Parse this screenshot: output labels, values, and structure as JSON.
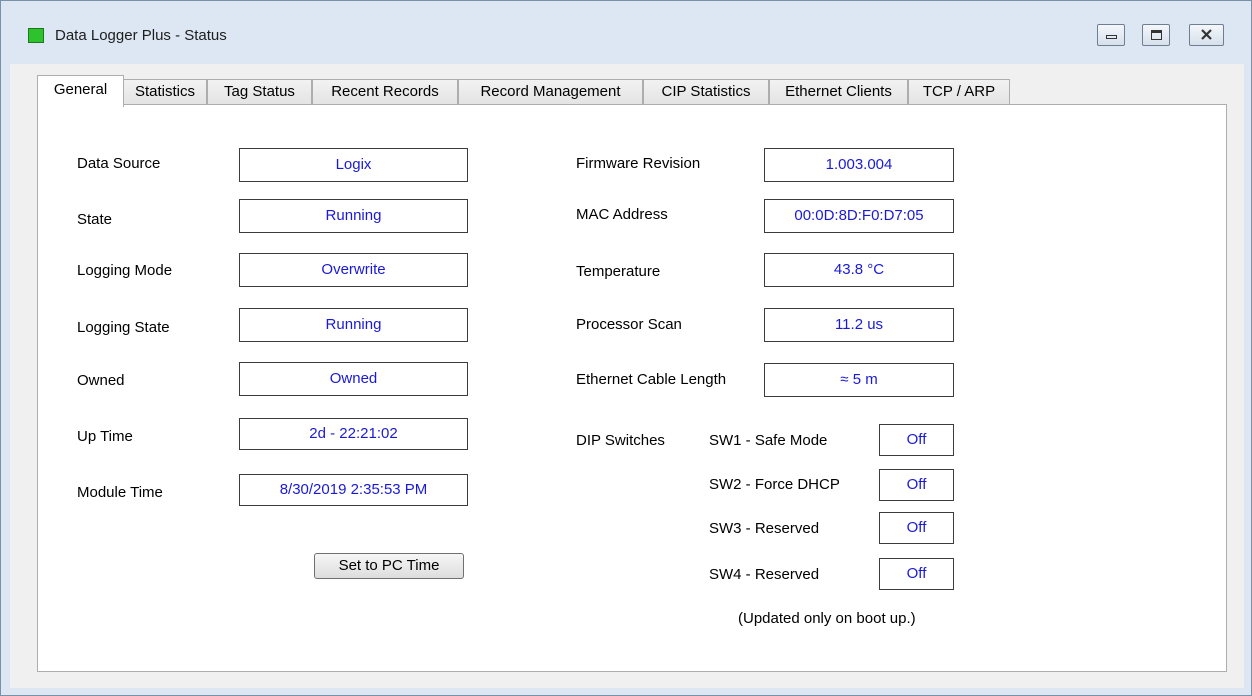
{
  "window": {
    "title": "Data Logger Plus - Status",
    "icon": "green-square-icon"
  },
  "tabs": [
    {
      "label": "General",
      "active": true
    },
    {
      "label": "Statistics",
      "active": false
    },
    {
      "label": "Tag Status",
      "active": false
    },
    {
      "label": "Recent Records",
      "active": false
    },
    {
      "label": "Record Management",
      "active": false
    },
    {
      "label": "CIP Statistics",
      "active": false
    },
    {
      "label": "Ethernet Clients",
      "active": false
    },
    {
      "label": "TCP / ARP",
      "active": false
    }
  ],
  "general": {
    "left": [
      {
        "label": "Data Source",
        "value": "Logix"
      },
      {
        "label": "State",
        "value": "Running"
      },
      {
        "label": "Logging Mode",
        "value": "Overwrite"
      },
      {
        "label": "Logging State",
        "value": "Running"
      },
      {
        "label": "Owned",
        "value": "Owned"
      },
      {
        "label": "Up Time",
        "value": "2d - 22:21:02"
      },
      {
        "label": "Module Time",
        "value": "8/30/2019 2:35:53 PM"
      }
    ],
    "set_time_button": "Set to PC Time",
    "right": [
      {
        "label": "Firmware Revision",
        "value": "1.003.004"
      },
      {
        "label": "MAC Address",
        "value": "00:0D:8D:F0:D7:05"
      },
      {
        "label": "Temperature",
        "value": "43.8 °C"
      },
      {
        "label": "Processor Scan",
        "value": "11.2 us"
      },
      {
        "label": "Ethernet Cable Length",
        "value": "≈ 5 m"
      }
    ],
    "dip": {
      "label": "DIP Switches",
      "switches": [
        {
          "label": "SW1 - Safe Mode",
          "value": "Off"
        },
        {
          "label": "SW2 - Force DHCP",
          "value": "Off"
        },
        {
          "label": "SW3 - Reserved",
          "value": "Off"
        },
        {
          "label": "SW4 - Reserved",
          "value": "Off"
        }
      ],
      "note": "(Updated only on boot up.)"
    }
  },
  "colors": {
    "value_text": "#1a1ad6",
    "window_frame": "#dce7f3",
    "status_icon": "#2fc22f"
  }
}
